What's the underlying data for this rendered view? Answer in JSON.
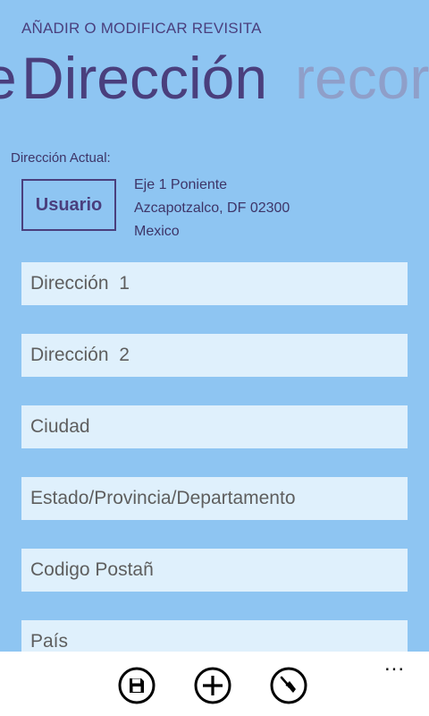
{
  "header": {
    "app_title": "AÑADIR O MODIFICAR REVISITA",
    "pivot": {
      "previous_fragment": "e",
      "active": "Dirección",
      "next": "recordatorio"
    }
  },
  "current_address": {
    "label": "Dirección Actual:",
    "user_button_label": "Usuario",
    "lines": [
      "Eje 1 Poniente",
      "Azcapotzalco, DF 02300",
      "Mexico"
    ]
  },
  "form": {
    "fields": [
      {
        "placeholder": "Dirección  1",
        "value": ""
      },
      {
        "placeholder": "Dirección  2",
        "value": ""
      },
      {
        "placeholder": "Ciudad",
        "value": ""
      },
      {
        "placeholder": "Estado/Provincia/Departamento",
        "value": ""
      },
      {
        "placeholder": "Codigo Postañ",
        "value": ""
      },
      {
        "placeholder": "País",
        "value": ""
      }
    ]
  },
  "app_bar": {
    "buttons": [
      {
        "icon": "save-icon"
      },
      {
        "icon": "add-icon"
      },
      {
        "icon": "clear-broom-icon"
      }
    ],
    "more": "..."
  },
  "colors": {
    "background": "#8ec5f2",
    "accent": "#4a3f7d",
    "field_background": "#dff0fc",
    "app_bar": "#ffffff"
  }
}
